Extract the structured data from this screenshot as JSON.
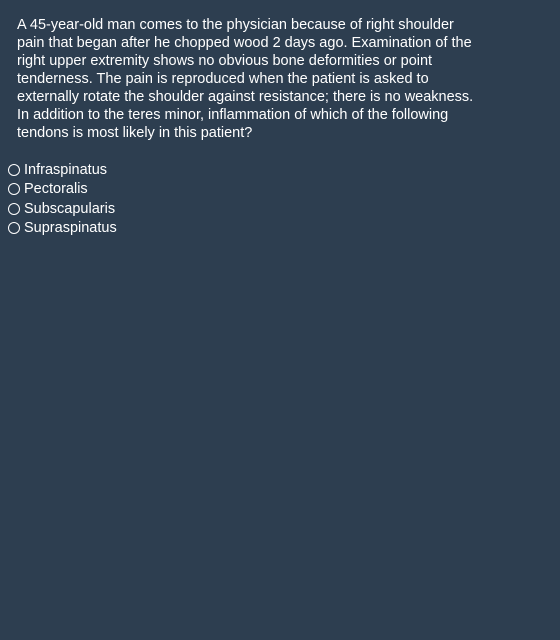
{
  "question": {
    "text": "A 45-year-old man comes to the physician because of right shoulder pain that began after he chopped wood 2 days ago. Examination of the right upper extremity shows no obvious bone deformities or point tenderness. The pain is reproduced when the patient is asked to externally rotate the shoulder against resistance; there is no weakness. In addition to the teres minor, inflammation of which of the following tendons is most likely in this patient?"
  },
  "options": [
    {
      "label": "Infraspinatus",
      "selected": false
    },
    {
      "label": "Pectoralis",
      "selected": false
    },
    {
      "label": "Subscapularis",
      "selected": false
    },
    {
      "label": "Supraspinatus",
      "selected": false
    }
  ],
  "colors": {
    "background": "#2d3e50",
    "text": "#ffffff"
  }
}
